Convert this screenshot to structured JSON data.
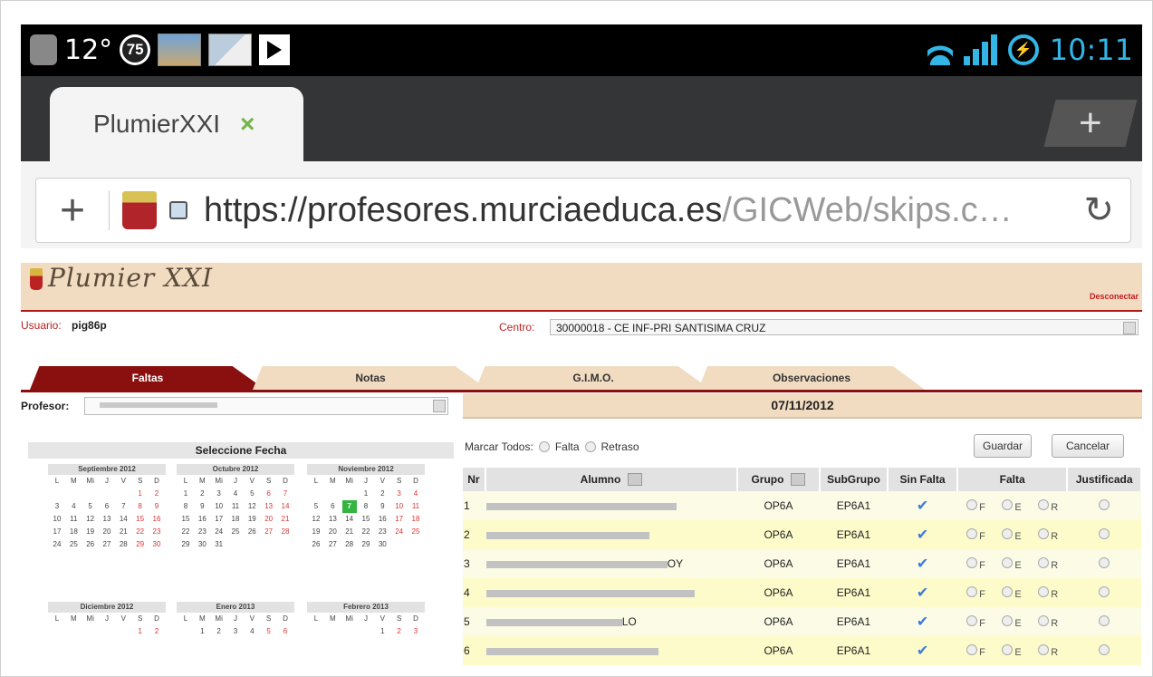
{
  "status_bar": {
    "temperature": "12°",
    "badge_number": "75",
    "clock": "10:11",
    "icons_left": [
      "headset-icon",
      "image-thumbnail-icon",
      "map-icon",
      "play-store-icon"
    ],
    "icons_right": [
      "wifi-icon",
      "signal-icon",
      "power-icon"
    ],
    "accent": "#33b5e5"
  },
  "browser": {
    "tab_title": "PlumierXXI",
    "tab_close": "×",
    "new_tab": "+",
    "url_host": "https://profesores.murciaeduca.es",
    "url_path": "/GICWeb/skips.c…",
    "reload_icon": "↻",
    "add_icon": "+"
  },
  "page": {
    "logo": "Plumier XXI",
    "desconectar": "Desconectar",
    "usuario_label": "Usuario:",
    "usuario_value": "pig86p",
    "centro_label": "Centro:",
    "centro_value": "30000018 - CE INF-PRI SANTISIMA CRUZ",
    "tabs": [
      {
        "label": "Faltas",
        "active": true
      },
      {
        "label": "Notas",
        "active": false
      },
      {
        "label": "G.I.M.O.",
        "active": false
      },
      {
        "label": "Observaciones",
        "active": false
      }
    ],
    "profesor_label": "Profesor:",
    "date": "07/11/2012",
    "seleccione_fecha": "Seleccione Fecha",
    "weekday_header": [
      "L",
      "M",
      "Mi",
      "J",
      "V",
      "S",
      "D"
    ],
    "calendars": [
      {
        "title": "Septiembre 2012",
        "rows": [
          [
            "",
            "",
            "",
            "",
            "",
            "1",
            "2"
          ],
          [
            "3",
            "4",
            "5",
            "6",
            "7",
            "8",
            "9"
          ],
          [
            "10",
            "11",
            "12",
            "13",
            "14",
            "15",
            "16"
          ],
          [
            "17",
            "18",
            "19",
            "20",
            "21",
            "22",
            "23"
          ],
          [
            "24",
            "25",
            "26",
            "27",
            "28",
            "29",
            "30"
          ]
        ]
      },
      {
        "title": "Octubre 2012",
        "rows": [
          [
            "1",
            "2",
            "3",
            "4",
            "5",
            "6",
            "7"
          ],
          [
            "8",
            "9",
            "10",
            "11",
            "12",
            "13",
            "14"
          ],
          [
            "15",
            "16",
            "17",
            "18",
            "19",
            "20",
            "21"
          ],
          [
            "22",
            "23",
            "24",
            "25",
            "26",
            "27",
            "28"
          ],
          [
            "29",
            "30",
            "31",
            "",
            "",
            "",
            ""
          ]
        ]
      },
      {
        "title": "Noviembre 2012",
        "rows": [
          [
            "",
            "",
            "",
            "1",
            "2",
            "3",
            "4"
          ],
          [
            "5",
            "6",
            "7",
            "8",
            "9",
            "10",
            "11"
          ],
          [
            "12",
            "13",
            "14",
            "15",
            "16",
            "17",
            "18"
          ],
          [
            "19",
            "20",
            "21",
            "22",
            "23",
            "24",
            "25"
          ],
          [
            "26",
            "27",
            "28",
            "29",
            "30",
            "",
            ""
          ]
        ]
      },
      {
        "title": "Diciembre 2012",
        "rows": [
          [
            "",
            "",
            "",
            "",
            "",
            "1",
            "2"
          ]
        ]
      },
      {
        "title": "Enero 2013",
        "rows": [
          [
            "",
            "1",
            "2",
            "3",
            "4",
            "5",
            "6"
          ]
        ]
      },
      {
        "title": "Febrero 2013",
        "rows": [
          [
            "",
            "",
            "",
            "",
            "1",
            "2",
            "3"
          ]
        ]
      }
    ],
    "today": "7",
    "marcar_todos": "Marcar Todos:",
    "marcar_falta": "Falta",
    "marcar_retraso": "Retraso",
    "guardar": "Guardar",
    "cancelar": "Cancelar",
    "table": {
      "headers": [
        "Nr",
        "Alumno",
        "Grupo",
        "SubGrupo",
        "Sin Falta",
        "Falta",
        "Justificada"
      ],
      "falta_options": [
        "F",
        "E",
        "R"
      ],
      "rows": [
        {
          "nr": "1",
          "suffix": "",
          "grupo": "OP6A",
          "subgrupo": "EP6A1"
        },
        {
          "nr": "2",
          "suffix": "",
          "grupo": "OP6A",
          "subgrupo": "EP6A1"
        },
        {
          "nr": "3",
          "suffix": "OY",
          "grupo": "OP6A",
          "subgrupo": "EP6A1"
        },
        {
          "nr": "4",
          "suffix": "",
          "grupo": "OP6A",
          "subgrupo": "EP6A1"
        },
        {
          "nr": "5",
          "suffix": "LO",
          "grupo": "OP6A",
          "subgrupo": "EP6A1"
        },
        {
          "nr": "6",
          "suffix": "",
          "grupo": "OP6A",
          "subgrupo": "EP6A1"
        }
      ]
    }
  }
}
